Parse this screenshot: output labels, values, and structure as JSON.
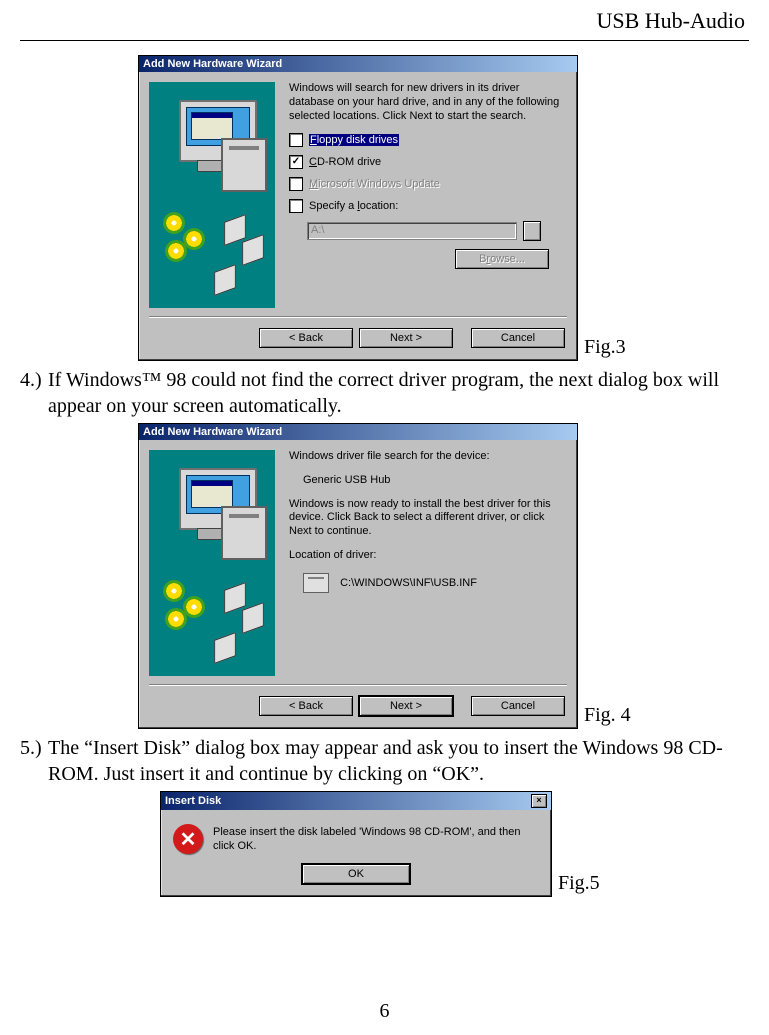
{
  "header": {
    "running": "USB Hub-Audio"
  },
  "fig3": {
    "title": "Add New Hardware Wizard",
    "intro": "Windows will search for new drivers in its driver database on your hard drive, and in any of the following selected locations. Click Next to start the search.",
    "opt_floppy": "Floppy disk drives",
    "opt_cdrom": "CD-ROM drive",
    "opt_winupd": "Microsoft Windows Update",
    "opt_spec": "Specify a location:",
    "path_value": "A:\\",
    "browse": "Browse...",
    "back": "< Back",
    "next": "Next >",
    "cancel": "Cancel",
    "caption": "Fig.3"
  },
  "step4": {
    "num": "4.)",
    "text": "If Windows™ 98 could not find the correct driver program, the next dialog box will appear on your screen automatically."
  },
  "fig4": {
    "title": "Add New Hardware Wizard",
    "line1": "Windows driver file search for the device:",
    "device": "Generic USB Hub",
    "line2": "Windows is now ready to install the best driver for this device. Click Back to select a different driver, or click Next to continue.",
    "loc_label": "Location of driver:",
    "loc_value": "C:\\WINDOWS\\INF\\USB.INF",
    "back": "< Back",
    "next": "Next >",
    "cancel": "Cancel",
    "caption": "Fig. 4"
  },
  "step5": {
    "num": "5.)",
    "text": "The “Insert Disk” dialog box may appear and ask you to insert the Windows 98 CD-ROM. Just insert it and continue by clicking on “OK”."
  },
  "fig5": {
    "title": "Insert Disk",
    "msg": "Please insert the disk labeled 'Windows 98 CD-ROM', and then click OK.",
    "ok": "OK",
    "caption": "Fig.5"
  },
  "page_number": "6"
}
